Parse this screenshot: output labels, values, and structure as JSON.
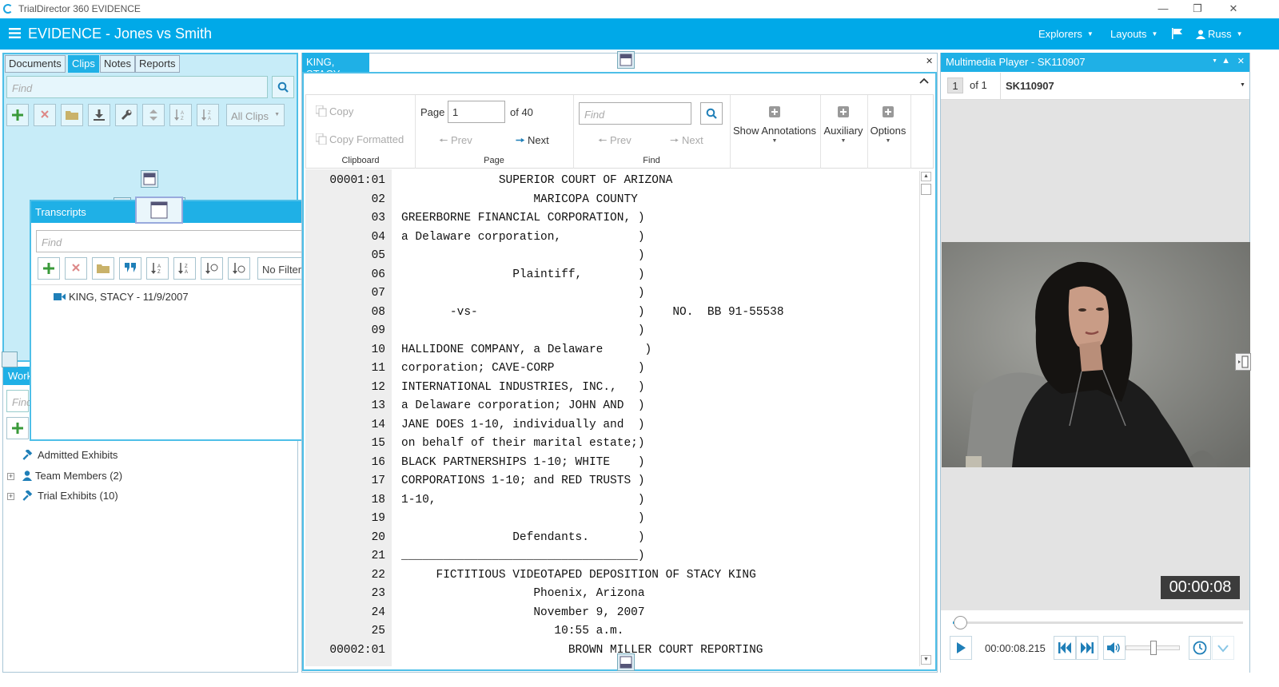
{
  "window": {
    "title": "TrialDirector 360 EVIDENCE"
  },
  "appbar": {
    "title": "EVIDENCE - Jones vs Smith",
    "explorers": "Explorers",
    "layouts": "Layouts",
    "user": "Russ"
  },
  "left": {
    "tabs": [
      "Documents",
      "Clips",
      "Notes",
      "Reports"
    ],
    "active_tab": "Clips",
    "find_placeholder": "Find",
    "clips_filter": "All Clips",
    "work_header": "Work",
    "work_find_placeholder": "Find",
    "tree": [
      {
        "label": "Admitted Exhibits",
        "expandable": false
      },
      {
        "label": "Team Members (2)",
        "expandable": true
      },
      {
        "label": "Trial Exhibits (10)",
        "expandable": true
      }
    ]
  },
  "transcripts": {
    "title": "Transcripts",
    "find_placeholder": "Find",
    "filter": "No Filter",
    "items": [
      {
        "label": "KING, STACY - 11/9/2007"
      }
    ]
  },
  "center": {
    "tab": "KING, STACY",
    "ribbon": {
      "clipboard": {
        "copy": "Copy",
        "copy_formatted": "Copy Formatted",
        "label": "Clipboard"
      },
      "page": {
        "page_label": "Page",
        "page_value": "1",
        "of": "of 40",
        "prev": "Prev",
        "next": "Next",
        "label": "Page"
      },
      "find": {
        "placeholder": "Find",
        "prev": "Prev",
        "next": "Next",
        "label": "Find"
      },
      "show_annotations": "Show Annotations",
      "auxiliary": "Auxiliary",
      "options": "Options"
    },
    "lines": [
      {
        "num": "00001:01",
        "text": "              SUPERIOR COURT OF ARIZONA"
      },
      {
        "num": "02",
        "text": "                   MARICOPA COUNTY"
      },
      {
        "num": "03",
        "text": "GREERBORNE FINANCIAL CORPORATION, )"
      },
      {
        "num": "04",
        "text": "a Delaware corporation,           )"
      },
      {
        "num": "05",
        "text": "                                  )"
      },
      {
        "num": "06",
        "text": "                Plaintiff,        )"
      },
      {
        "num": "07",
        "text": "                                  )"
      },
      {
        "num": "08",
        "text": "       -vs-                       )    NO.  BB 91-55538"
      },
      {
        "num": "09",
        "text": "                                  )"
      },
      {
        "num": "10",
        "text": "HALLIDONE COMPANY, a Delaware      )"
      },
      {
        "num": "11",
        "text": "corporation; CAVE-CORP            )"
      },
      {
        "num": "12",
        "text": "INTERNATIONAL INDUSTRIES, INC.,   )"
      },
      {
        "num": "13",
        "text": "a Delaware corporation; JOHN AND  )"
      },
      {
        "num": "14",
        "text": "JANE DOES 1-10, individually and  )"
      },
      {
        "num": "15",
        "text": "on behalf of their marital estate;)"
      },
      {
        "num": "16",
        "text": "BLACK PARTNERSHIPS 1-10; WHITE    )"
      },
      {
        "num": "17",
        "text": "CORPORATIONS 1-10; and RED TRUSTS )"
      },
      {
        "num": "18",
        "text": "1-10,                             )"
      },
      {
        "num": "19",
        "text": "                                  )"
      },
      {
        "num": "20",
        "text": "                Defendants.       )"
      },
      {
        "num": "21",
        "text": "__________________________________)"
      },
      {
        "num": "22",
        "text": "     FICTITIOUS VIDEOTAPED DEPOSITION OF STACY KING"
      },
      {
        "num": "23",
        "text": "                   Phoenix, Arizona"
      },
      {
        "num": "24",
        "text": "                   November 9, 2007"
      },
      {
        "num": "25",
        "text": "                      10:55 a.m."
      },
      {
        "num": "00002:01",
        "text": "                        BROWN MILLER COURT REPORTING"
      }
    ]
  },
  "player": {
    "title": "Multimedia Player - SK110907",
    "index": "1",
    "of": "of 1",
    "media_name": "SK110907",
    "timecode": "00:00:08",
    "position": "00:00:08.215",
    "progress": 0.01,
    "volume": 0.45
  }
}
